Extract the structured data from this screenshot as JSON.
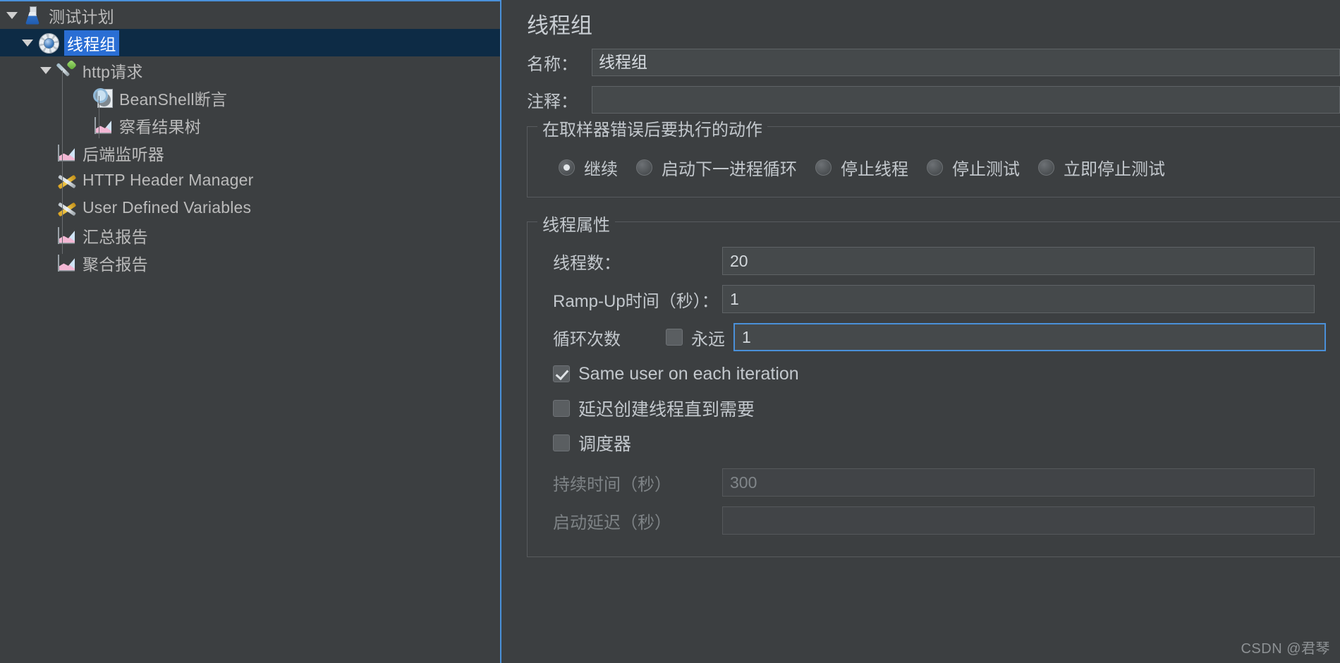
{
  "tree": {
    "items": [
      {
        "label": "测试计划",
        "icon": "flask-icon",
        "depth": 0,
        "toggle": "open",
        "selected": false
      },
      {
        "label": "线程组",
        "icon": "gear-icon",
        "depth": 1,
        "toggle": "open",
        "selected": true
      },
      {
        "label": "http请求",
        "icon": "pipette-icon",
        "depth": 2,
        "toggle": "open",
        "selected": false
      },
      {
        "label": "BeanShell断言",
        "icon": "assertion-icon",
        "depth": 3,
        "toggle": "none",
        "selected": false
      },
      {
        "label": "察看结果树",
        "icon": "chart-icon",
        "depth": 3,
        "toggle": "none",
        "selected": false
      },
      {
        "label": "后端监听器",
        "icon": "chart-icon",
        "depth": 2,
        "toggle": "none",
        "selected": false
      },
      {
        "label": "HTTP Header Manager",
        "icon": "tools-icon",
        "depth": 2,
        "toggle": "none",
        "selected": false
      },
      {
        "label": "User Defined Variables",
        "icon": "tools-icon",
        "depth": 2,
        "toggle": "none",
        "selected": false
      },
      {
        "label": "汇总报告",
        "icon": "chart-icon",
        "depth": 2,
        "toggle": "none",
        "selected": false
      },
      {
        "label": "聚合报告",
        "icon": "chart-icon",
        "depth": 2,
        "toggle": "none",
        "selected": false
      }
    ]
  },
  "detail": {
    "title": "线程组",
    "name_label": "名称：",
    "name_value": "线程组",
    "comment_label": "注释：",
    "comment_value": "",
    "comment_placeholder": "",
    "error_action": {
      "group_title": "在取样器错误后要执行的动作",
      "options": [
        {
          "label": "继续",
          "checked": true
        },
        {
          "label": "启动下一进程循环",
          "checked": false
        },
        {
          "label": "停止线程",
          "checked": false
        },
        {
          "label": "停止测试",
          "checked": false
        },
        {
          "label": "立即停止测试",
          "checked": false
        }
      ]
    },
    "thread_props": {
      "group_title": "线程属性",
      "num_threads_label": "线程数：",
      "num_threads_value": "20",
      "ramp_up_label": "Ramp-Up时间（秒）：",
      "ramp_up_value": "1",
      "loop_count_label": "循环次数",
      "forever_label": "永远",
      "forever_checked": false,
      "loop_count_value": "1",
      "same_user_label": "Same user on each iteration",
      "same_user_checked": true,
      "delay_create_label": "延迟创建线程直到需要",
      "delay_create_checked": false,
      "scheduler_label": "调度器",
      "scheduler_checked": false,
      "duration_label": "持续时间（秒）",
      "duration_value": "300",
      "startup_delay_label": "启动延迟（秒）",
      "startup_delay_value": ""
    }
  },
  "watermark": "CSDN @君琴",
  "colors": {
    "accent": "#4a90d9",
    "selection": "#2a6ed4",
    "selected_row_bg": "#0d2b45",
    "background": "#3c3f41",
    "text": "#c3c8cd"
  }
}
